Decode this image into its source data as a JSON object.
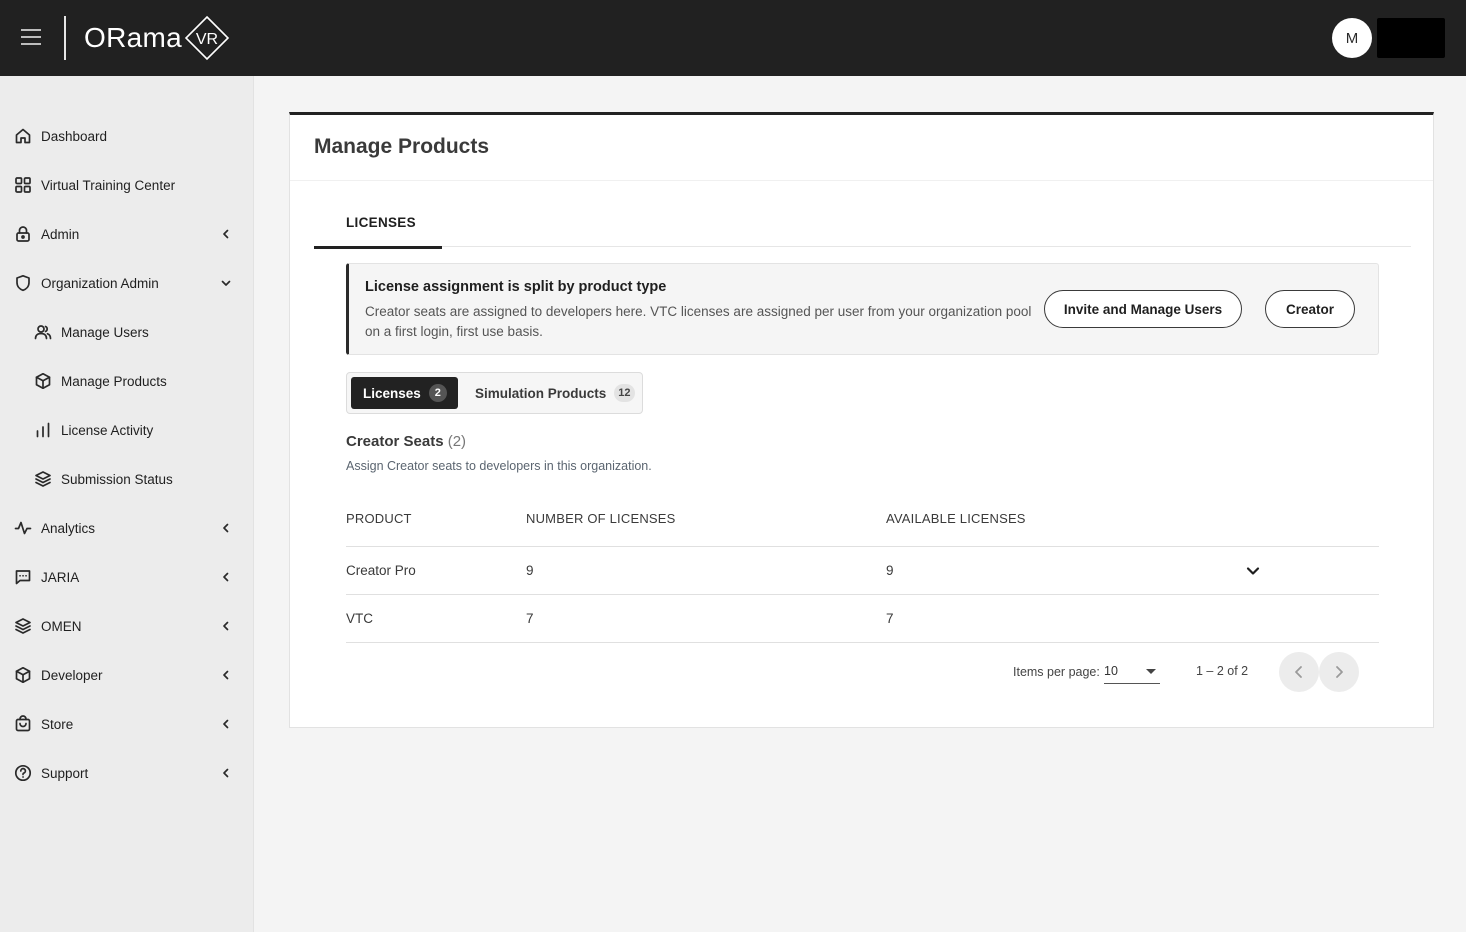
{
  "header": {
    "logo_text": "ORama",
    "logo_mark": "VR",
    "avatar_initial": "M"
  },
  "sidebar": {
    "items": [
      {
        "label": "Dashboard",
        "icon": "home-icon"
      },
      {
        "label": "Virtual Training Center",
        "icon": "grid-icon"
      },
      {
        "label": "Admin",
        "icon": "lock-icon",
        "chevron": "left"
      },
      {
        "label": "Organization Admin",
        "icon": "shield-icon",
        "chevron": "down"
      },
      {
        "label": "Manage Users",
        "icon": "users-icon",
        "sub": true
      },
      {
        "label": "Manage Products",
        "icon": "cube-icon",
        "sub": true
      },
      {
        "label": "License Activity",
        "icon": "bar-chart-icon",
        "sub": true
      },
      {
        "label": "Submission Status",
        "icon": "layers-icon",
        "sub": true
      },
      {
        "label": "Analytics",
        "icon": "activity-icon",
        "chevron": "left"
      },
      {
        "label": "JARIA",
        "icon": "message-icon",
        "chevron": "left"
      },
      {
        "label": "OMEN",
        "icon": "layers-icon",
        "chevron": "left"
      },
      {
        "label": "Developer",
        "icon": "cube-icon",
        "chevron": "left"
      },
      {
        "label": "Store",
        "icon": "bag-icon",
        "chevron": "left"
      },
      {
        "label": "Support",
        "icon": "help-icon",
        "chevron": "left"
      }
    ]
  },
  "main": {
    "title": "Manage Products",
    "tabs": [
      {
        "label": "LICENSES",
        "active": true
      }
    ],
    "notice": {
      "title": "License assignment is split by product type",
      "body": "Creator seats are assigned to developers here. VTC licenses are assigned per user from your organization pool on a first login, first use basis.",
      "invite_label": "Invite and Manage Users",
      "creator_label": "Creator"
    },
    "segments": [
      {
        "label": "Licenses",
        "count": "2",
        "active": true
      },
      {
        "label": "Simulation Products",
        "count": "12",
        "active": false
      }
    ],
    "section": {
      "title": "Creator Seats",
      "count": "(2)",
      "subtitle": "Assign Creator seats to developers in this organization."
    },
    "table": {
      "columns": [
        "PRODUCT",
        "NUMBER OF LICENSES",
        "AVAILABLE LICENSES"
      ],
      "rows": [
        {
          "product": "Creator Pro",
          "number": "9",
          "available": "9"
        },
        {
          "product": "VTC",
          "number": "7",
          "available": "7"
        }
      ]
    },
    "pagination": {
      "items_per_page_label": "Items per page:",
      "items_per_page_value": "10",
      "range": "1 – 2 of 2"
    }
  }
}
